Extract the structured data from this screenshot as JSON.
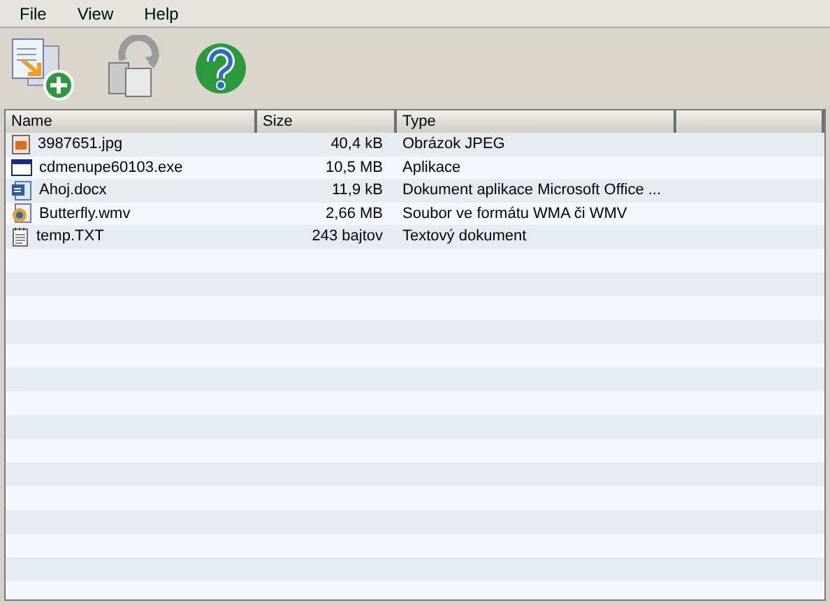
{
  "menu": [
    {
      "label": "File"
    },
    {
      "label": "View"
    },
    {
      "label": "Help"
    }
  ],
  "columns": [
    {
      "label": "Name"
    },
    {
      "label": "Size"
    },
    {
      "label": "Type"
    }
  ],
  "rows": [
    {
      "kind": "image",
      "name": "3987651.jpg",
      "size": "40,4 kB",
      "type": "Obrázok JPEG"
    },
    {
      "kind": "program",
      "name": "cdmenupe60103.exe",
      "size": "10,5 MB",
      "type": "Aplikace"
    },
    {
      "kind": "document",
      "name": "Ahoj.docx",
      "size": "11,9 kB",
      "type": "Dokument aplikace Microsoft Office ..."
    },
    {
      "kind": "video",
      "name": "Butterfly.wmv",
      "size": "2,66 MB",
      "type": "Soubor ve formátu WMA či WMV"
    },
    {
      "kind": "text",
      "name": "temp.TXT",
      "size": "243 bajtov",
      "type": "Textový dokument"
    }
  ]
}
